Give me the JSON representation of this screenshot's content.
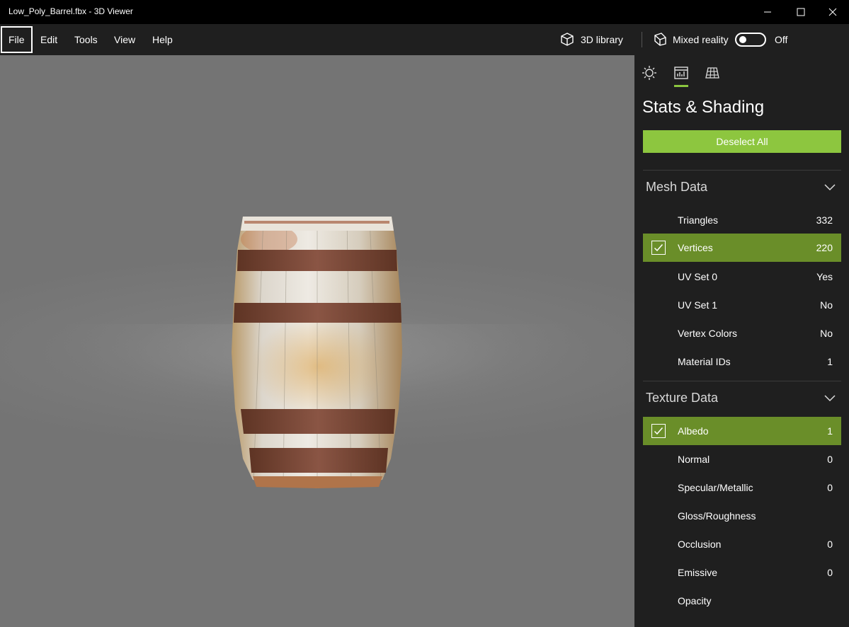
{
  "window": {
    "title": "Low_Poly_Barrel.fbx - 3D Viewer",
    "minimize_icon": "minimize-icon",
    "maximize_icon": "maximize-icon",
    "close_icon": "close-icon"
  },
  "menu": {
    "items": [
      "File",
      "Edit",
      "Tools",
      "View",
      "Help"
    ],
    "selected": "File"
  },
  "commands": {
    "library_label": "3D library",
    "mixed_reality_label": "Mixed reality",
    "toggle_state": "Off"
  },
  "panel": {
    "tabs": [
      "lighting-icon",
      "stats-icon",
      "grid-icon"
    ],
    "active_tab": "stats-icon",
    "title": "Stats & Shading",
    "deselect_label": "Deselect All",
    "accent_color": "#8dc63f",
    "selected_row_color": "#6a8e29",
    "mesh": {
      "title": "Mesh Data",
      "rows": [
        {
          "label": "Triangles",
          "value": "332",
          "checked": false
        },
        {
          "label": "Vertices",
          "value": "220",
          "checked": true
        },
        {
          "label": "UV Set 0",
          "value": "Yes",
          "checked": false
        },
        {
          "label": "UV Set 1",
          "value": "No",
          "checked": false
        },
        {
          "label": "Vertex Colors",
          "value": "No",
          "checked": false
        },
        {
          "label": "Material IDs",
          "value": "1",
          "checked": false
        }
      ]
    },
    "texture": {
      "title": "Texture Data",
      "rows": [
        {
          "label": "Albedo",
          "value": "1",
          "checked": true
        },
        {
          "label": "Normal",
          "value": "0",
          "checked": false
        },
        {
          "label": "Specular/Metallic",
          "value": "0",
          "checked": false
        },
        {
          "label": "Gloss/Roughness",
          "value": "",
          "checked": false
        },
        {
          "label": "Occlusion",
          "value": "0",
          "checked": false
        },
        {
          "label": "Emissive",
          "value": "0",
          "checked": false
        },
        {
          "label": "Opacity",
          "value": "",
          "checked": false
        }
      ]
    }
  }
}
